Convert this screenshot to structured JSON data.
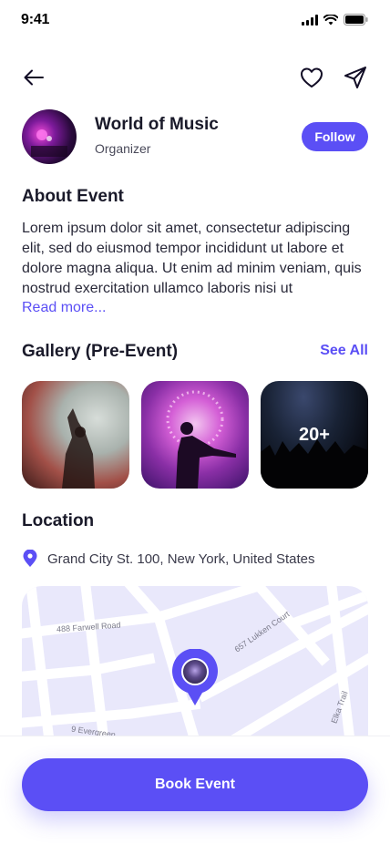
{
  "status_bar": {
    "time": "9:41"
  },
  "organizer": {
    "name": "World of Music",
    "role": "Organizer",
    "follow_label": "Follow"
  },
  "about": {
    "title": "About Event",
    "text": "Lorem ipsum dolor sit amet, consectetur adipiscing elit, sed do eiusmod tempor incididunt ut labore et dolore magna aliqua. Ut enim ad minim veniam, quis nostrud exercitation ullamco laboris nisi ut",
    "read_more": "Read more..."
  },
  "gallery": {
    "title": "Gallery (Pre-Event)",
    "see_all": "See All",
    "more_count": "20+"
  },
  "location": {
    "title": "Location",
    "address": "Grand City St. 100, New York, United States",
    "map_labels": [
      "488 Farwell Road",
      "657 Lukken Court",
      "9 Evergreen",
      "Elka Trail"
    ]
  },
  "cta": {
    "book_label": "Book Event"
  },
  "colors": {
    "accent": "#5b4ff5",
    "map_bg": "#e9e8fb",
    "text": "#1a1a2a"
  }
}
